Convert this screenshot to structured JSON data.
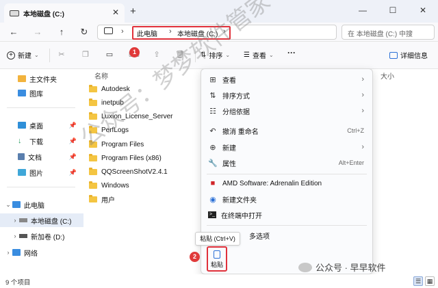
{
  "window": {
    "tab_title": "本地磁盘 (C:)",
    "new_tab": "+",
    "minimize": "—",
    "maximize": "☐",
    "close": "✕"
  },
  "address": {
    "crumbs": [
      "此电脑",
      "本地磁盘 (C:)"
    ],
    "search_placeholder": "在 本地磁盘 (C:) 中搜"
  },
  "toolbar": {
    "new_label": "新建",
    "sort_label": "排序",
    "view_label": "查看",
    "more_label": "···",
    "details_label": "详细信息",
    "badge_1": "1",
    "badge_2": "2"
  },
  "sidebar": {
    "items": [
      {
        "label": "主文件夹",
        "icon": "home-icon"
      },
      {
        "label": "图库",
        "icon": "gallery-icon"
      },
      {
        "label": "桌面",
        "icon": "desktop-icon"
      },
      {
        "label": "下载",
        "icon": "download-icon"
      },
      {
        "label": "文档",
        "icon": "document-icon"
      },
      {
        "label": "图片",
        "icon": "picture-icon"
      },
      {
        "label": "此电脑",
        "icon": "pc-icon"
      },
      {
        "label": "本地磁盘 (C:)",
        "icon": "drive-icon"
      },
      {
        "label": "新加卷 (D:)",
        "icon": "drive-icon"
      },
      {
        "label": "网络",
        "icon": "network-icon"
      }
    ]
  },
  "columns": {
    "name": "名称",
    "size": "大小"
  },
  "files": [
    "Autodesk",
    "inetpub",
    "Luxion_License_Server",
    "PerfLogs",
    "Program Files",
    "Program Files (x86)",
    "QQScreenShotV2.4.1",
    "Windows",
    "用户"
  ],
  "context_menu": {
    "items": [
      {
        "label": "查看",
        "icon": "grid-icon",
        "shortcut": "",
        "submenu": true
      },
      {
        "label": "排序方式",
        "icon": "sort-icon",
        "shortcut": "",
        "submenu": true
      },
      {
        "label": "分组依据",
        "icon": "group-icon",
        "shortcut": "",
        "submenu": true
      },
      {
        "label": "撤消 重命名",
        "icon": "undo-icon",
        "shortcut": "Ctrl+Z",
        "submenu": false
      },
      {
        "label": "新建",
        "icon": "new-icon",
        "shortcut": "",
        "submenu": true
      },
      {
        "label": "属性",
        "icon": "wrench-icon",
        "shortcut": "Alt+Enter",
        "submenu": false
      },
      {
        "label": "AMD Software: Adrenalin Edition",
        "icon": "amd-icon",
        "shortcut": "",
        "submenu": false
      },
      {
        "label": "新建文件夹",
        "icon": "folder-plus-icon",
        "shortcut": "",
        "submenu": false
      },
      {
        "label": "在终端中打开",
        "icon": "terminal-icon",
        "shortcut": "",
        "submenu": false
      },
      {
        "label": "多选项",
        "icon": "more-options-icon",
        "shortcut": "",
        "submenu": false
      }
    ],
    "tooltip": "粘贴 (Ctrl+V)",
    "paste_label": "粘贴"
  },
  "status": {
    "item_count": "9 个项目"
  },
  "watermark": {
    "text": "公众号：梦梦软件管家",
    "brand": "公众号 · 早早软件"
  },
  "colors": {
    "accent": "#2a6fd6",
    "highlight": "#e0303a",
    "selected": "#e5ecf7"
  }
}
